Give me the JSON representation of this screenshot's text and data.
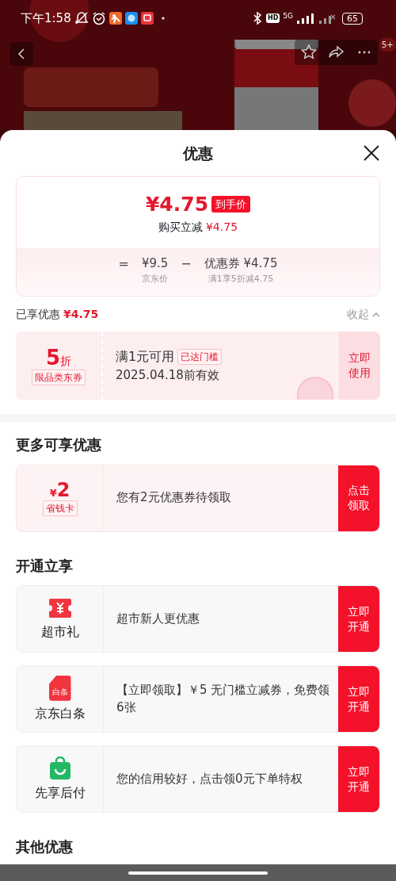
{
  "status_bar": {
    "time": "下午1:58",
    "hd": "HD",
    "network": "5G",
    "battery": "65"
  },
  "nav": {
    "badge": "5+"
  },
  "sheet": {
    "title": "优惠"
  },
  "price_summary": {
    "final_price": "¥4.75",
    "final_label": "到手价",
    "reduction_label": "购买立减",
    "reduction": "¥4.75",
    "equals": "=",
    "base_price": "¥9.5",
    "base_label": "京东价",
    "minus": "−",
    "coupon_price": "优惠券 ¥4.75",
    "coupon_note": "满1享5折减4.75"
  },
  "applied": {
    "label": "已享优惠",
    "amount": "¥4.75",
    "toggle": "收起",
    "expanded": true
  },
  "applied_coupons": [
    {
      "value": "5",
      "unit": "折",
      "tag": "限品类东券",
      "title": "满1元可用",
      "status": "已达门槛",
      "validity": "2025.04.18前有效",
      "action": "立即使用"
    }
  ],
  "sections": [
    {
      "title": "更多可享优惠",
      "offers": [
        {
          "kind": "amount",
          "currency": "¥",
          "value": "2",
          "tag": "省钱卡",
          "text": "您有2元优惠券待领取",
          "action": "点击领取"
        }
      ]
    },
    {
      "title": "开通立享",
      "offers": [
        {
          "kind": "ticket",
          "name": "超市礼",
          "text": "超市新人更优惠",
          "action": "立即开通"
        },
        {
          "kind": "card",
          "icon_text": "白条",
          "name": "京东白条",
          "text": "【立即领取】￥5 无门槛立减券，免费领6张",
          "action": "立即开通"
        },
        {
          "kind": "bag",
          "name": "先享后付",
          "text": "您的信用较好，点击领0元下单特权",
          "action": "立即开通"
        }
      ]
    },
    {
      "title": "其他优惠"
    }
  ]
}
